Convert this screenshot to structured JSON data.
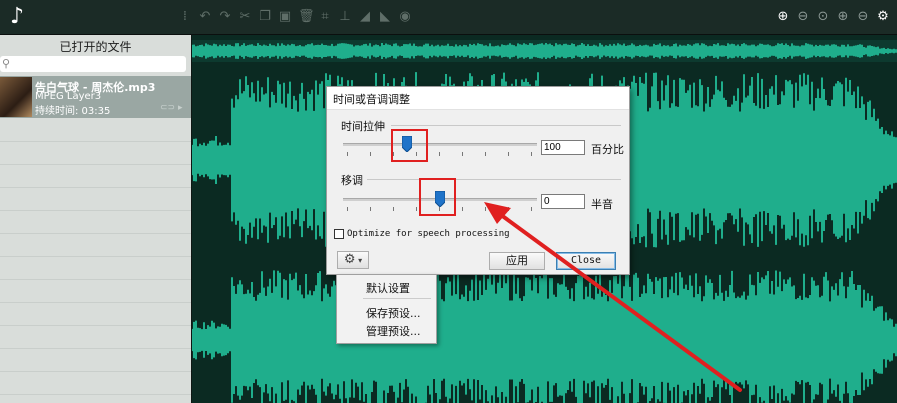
{
  "toolbar": {
    "app_icon": "music-note-icon",
    "edit_icons": [
      "undo-icon",
      "redo-icon",
      "cut-icon",
      "copy-icon",
      "paste-icon",
      "delete-icon",
      "crop-icon",
      "normalize-icon",
      "fade-in-icon",
      "fade-out-icon",
      "sound-icon"
    ],
    "zoom_icons": [
      "zoom-in-icon",
      "zoom-out-icon",
      "zoom-selection-icon",
      "zoom-fit-icon",
      "zoom-full-icon",
      "zoom-settings-icon"
    ]
  },
  "sidebar": {
    "title": "已打开的文件",
    "search": {
      "value": "",
      "placeholder": ""
    },
    "file": {
      "name": "告白气球 - 周杰伦.mp3",
      "format": "MPEG Layer3",
      "duration": "持续时间: 03:35"
    }
  },
  "dialog": {
    "title": "时间或音调调整",
    "time_stretch": {
      "label": "时间拉伸",
      "value": "100",
      "unit": "百分比",
      "level": 0.33
    },
    "pitch": {
      "label": "移调",
      "value": "0",
      "unit": "半音",
      "level": 0.5
    },
    "checkbox": {
      "label": "Optimize for speech processing",
      "checked": false
    },
    "apply_label": "应用",
    "close_label": "Close"
  },
  "preset_menu": {
    "items": [
      "默认设置",
      "保存预设...",
      "管理预设..."
    ]
  },
  "colors": {
    "waveform": "#1fae8c",
    "waveform_bg": "#0b2a22",
    "highlight": "#e02020",
    "slider_thumb": "#1f73c9"
  }
}
